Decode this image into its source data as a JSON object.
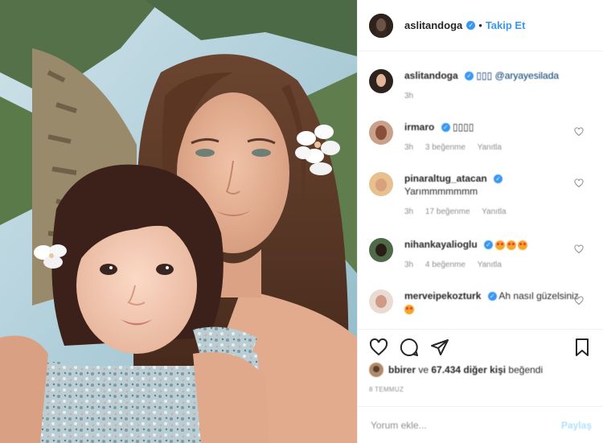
{
  "header": {
    "username": "aslitandoga",
    "verified_icon": "verified-badge-icon",
    "separator": "•",
    "follow_label": "Takip Et"
  },
  "caption": {
    "username": "aslitandoga",
    "text": "▯▯▯ @aryayesilada",
    "time": "3h"
  },
  "comments": [
    {
      "username": "irmaro",
      "verified": true,
      "text": "▯▯▯▯",
      "time": "3h",
      "likes": "3 beğenme",
      "reply": "Yanıtla"
    },
    {
      "username": "pinaraltug_atacan",
      "verified": true,
      "text": "Yarımmmmmmm",
      "time": "3h",
      "likes": "17 beğenme",
      "reply": "Yanıtla"
    },
    {
      "username": "nihankayalioglu",
      "verified": true,
      "text": "",
      "emoji_count": 3,
      "time": "3h",
      "likes": "4 beğenme",
      "reply": "Yanıtla"
    },
    {
      "username": "merveipekozturk",
      "verified": true,
      "text": "Ah nasıl güzelsiniz",
      "emoji_count": 1,
      "time": "",
      "likes": "",
      "reply": ""
    }
  ],
  "actions": {
    "like_icon": "heart-icon",
    "comment_icon": "comment-icon",
    "share_icon": "share-icon",
    "save_icon": "bookmark-icon"
  },
  "likes": {
    "first_user": "bbirer",
    "connector": " ve ",
    "count": "67.434 diğer kişi",
    "suffix": " beğendi"
  },
  "date": "8 TEMMUZ",
  "add_comment": {
    "placeholder": "Yorum ekle...",
    "post_label": "Paylaş"
  },
  "colors": {
    "accent": "#3897f0",
    "muted": "#8e8e8e",
    "border": "#efefef"
  }
}
